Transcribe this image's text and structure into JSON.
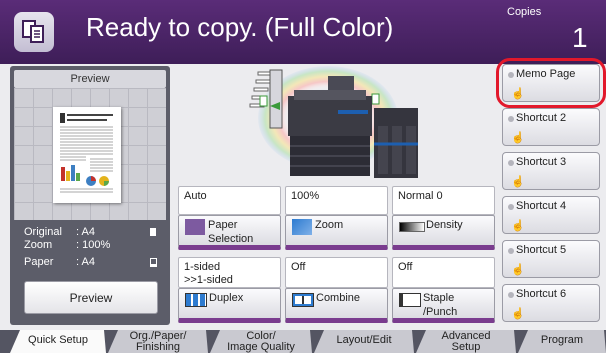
{
  "header": {
    "title": "Ready to copy. (Full Color)",
    "copies_label": "Copies",
    "copies_value": "1",
    "app_icon": "copy-icon"
  },
  "preview": {
    "header": "Preview",
    "doc_title": "Drawing Dots forms with art market",
    "original_label": "Original",
    "original_value": ": A4",
    "zoom_label": "Zoom",
    "zoom_value": ": 100%",
    "paper_label": "Paper",
    "paper_value": ": A4",
    "button": "Preview"
  },
  "functions": {
    "paper_value": "Auto",
    "paper_btn": [
      "Paper",
      "Selection"
    ],
    "zoom_value": "100%",
    "zoom_btn": "Zoom",
    "density_value": "Normal 0",
    "density_btn": "Density",
    "duplex_value": [
      "1-sided",
      ">>1-sided"
    ],
    "duplex_btn": "Duplex",
    "combine_value": "Off",
    "combine_btn": "Combine",
    "staple_value": "Off",
    "staple_btn": [
      "Staple",
      "/Punch"
    ]
  },
  "shortcuts": [
    "Memo Page",
    "Shortcut 2",
    "Shortcut 3",
    "Shortcut 4",
    "Shortcut 5",
    "Shortcut 6"
  ],
  "tabs": [
    [
      "Quick Setup"
    ],
    [
      "Org./Paper/",
      "Finishing"
    ],
    [
      "Color/",
      "Image Quality"
    ],
    [
      "Layout/Edit"
    ],
    [
      "Advanced",
      "Setup"
    ],
    [
      "Program"
    ]
  ],
  "colors": {
    "header": "#4b2467",
    "accent": "#7a3c8e",
    "highlight": "#e2182b"
  }
}
